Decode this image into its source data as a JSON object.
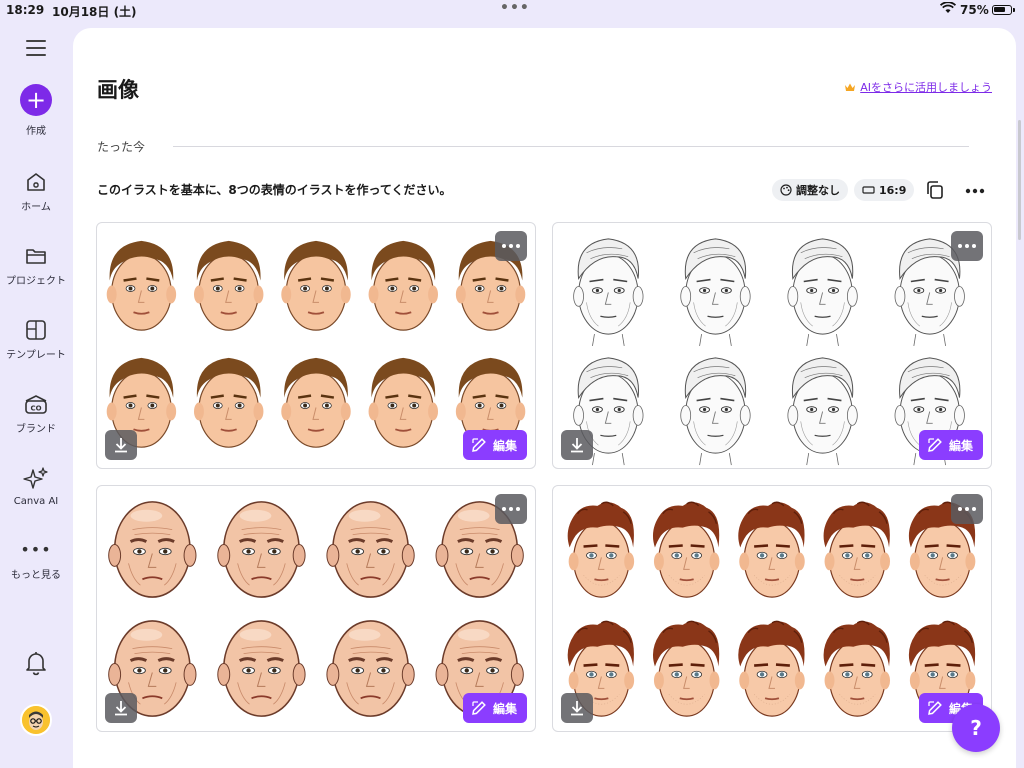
{
  "status_bar": {
    "time": "18:29",
    "date": "10月18日 (土)",
    "battery": "75%"
  },
  "sidebar": {
    "items": [
      {
        "label": "作成",
        "icon": "plus-icon"
      },
      {
        "label": "ホーム",
        "icon": "home-icon"
      },
      {
        "label": "プロジェクト",
        "icon": "folder-icon"
      },
      {
        "label": "テンプレート",
        "icon": "template-icon"
      },
      {
        "label": "ブランド",
        "icon": "brand-icon"
      },
      {
        "label": "Canva AI",
        "icon": "sparkle-icon"
      },
      {
        "label": "もっと見る",
        "icon": "more-icon"
      }
    ]
  },
  "main": {
    "title": "画像",
    "ai_link": "AIをさらに活用しましょう",
    "time_label": "たった今",
    "prompt": "このイラストを基本に、8つの表情のイラストを作ってください。",
    "chip_adjust": "調整なし",
    "chip_ratio": "16:9",
    "tiles": [
      {
        "edit_label": "編集",
        "style": "cartoon-brown-hair"
      },
      {
        "edit_label": "編集",
        "style": "pencil-sketch"
      },
      {
        "edit_label": "編集",
        "style": "bald-older-man"
      },
      {
        "edit_label": "編集",
        "style": "curly-auburn-hair"
      }
    ]
  },
  "help_label": "?",
  "colors": {
    "accent": "#8b3dff",
    "create": "#7d2ae8",
    "sidebar_bg": "#ece9fb"
  }
}
